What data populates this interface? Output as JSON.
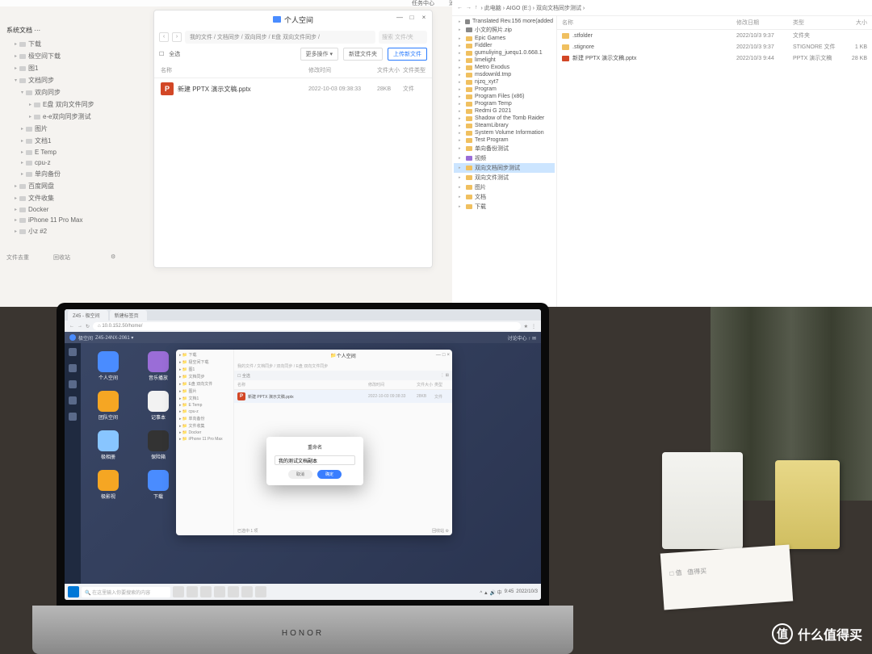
{
  "monitor": {
    "topbar": [
      "任务中心",
      "消息",
      "●",
      "●"
    ],
    "side_tree": {
      "header": "系统文档  ···",
      "items": [
        {
          "l": "下载",
          "i": 0
        },
        {
          "l": "极空间下载",
          "i": 0
        },
        {
          "l": "图1",
          "i": 0
        },
        {
          "l": "文档同步",
          "i": 0,
          "exp": true
        },
        {
          "l": "双向同步",
          "i": 1,
          "exp": true
        },
        {
          "l": "E盘 双向文件同步",
          "i": 2
        },
        {
          "l": "e-e双向同步测试",
          "i": 2
        },
        {
          "l": "图片",
          "i": 1
        },
        {
          "l": "文档1",
          "i": 1
        },
        {
          "l": "E Temp",
          "i": 1
        },
        {
          "l": "cpu-z",
          "i": 1
        },
        {
          "l": "单向备份",
          "i": 1
        },
        {
          "l": "百度网盘",
          "i": 0
        },
        {
          "l": "文件收集",
          "i": 0
        },
        {
          "l": "Docker",
          "i": 0
        },
        {
          "l": "iPhone 11 Pro Max",
          "i": 0
        },
        {
          "l": "小z #2",
          "i": 0
        }
      ],
      "footer": [
        "文件去重",
        "回收站",
        "⚙"
      ]
    },
    "nas_win": {
      "title": "个人空间",
      "nav_arrows": [
        "‹",
        "›"
      ],
      "breadcrumb": "我的文件 / 文档同步 / 双向同步 / E盘 双向文件同步 /",
      "search_ph": "搜索 文件/夹",
      "toolbar": {
        "all": "全选",
        "more": "更多操作 ▾",
        "new": "新建文件夹",
        "upload": "上传新文件"
      },
      "columns": [
        "名称",
        "修改时间",
        "文件大小",
        "文件类型"
      ],
      "rows": [
        {
          "name": "新建 PPTX 演示文稿.pptx",
          "date": "2022-10-03 09:38:33",
          "size": "28KB",
          "type": "文件"
        }
      ]
    },
    "explorer": {
      "addr": {
        "arrows": [
          "←",
          "→",
          "↑"
        ],
        "path": "› 此电脑 › AIGO (E:) › 双向文档同步测试 ›"
      },
      "tree": [
        {
          "l": "Translated Rev.156 more(added",
          "ic": "gr"
        },
        {
          "l": "小文的照片.zip",
          "ic": "gr"
        },
        {
          "l": "Epic Games"
        },
        {
          "l": "Fiddler"
        },
        {
          "l": "gumuliying_juequ1.0.668.1"
        },
        {
          "l": "limelight"
        },
        {
          "l": "Metro Exodus"
        },
        {
          "l": "msdownld.tmp"
        },
        {
          "l": "njzq_xyt7"
        },
        {
          "l": "Program"
        },
        {
          "l": "Program Files (x86)"
        },
        {
          "l": "Program Temp"
        },
        {
          "l": "Redmi G 2021"
        },
        {
          "l": "Shadow of the Tomb Raider"
        },
        {
          "l": "SteamLibrary"
        },
        {
          "l": "System Volume Information"
        },
        {
          "l": "Test Program"
        },
        {
          "l": "单向备份测试"
        },
        {
          "l": "视频",
          "ic": "pur"
        },
        {
          "l": "双向文档同步测试",
          "sel": true
        },
        {
          "l": "双向文件测试"
        },
        {
          "l": "图片"
        },
        {
          "l": "文档"
        },
        {
          "l": "下载"
        }
      ],
      "columns": [
        "名称",
        "修改日期",
        "类型",
        "大小"
      ],
      "rows": [
        {
          "name": ".stfolder",
          "date": "2022/10/3 9:37",
          "type": "文件夹",
          "size": ""
        },
        {
          "name": ".stignore",
          "date": "2022/10/3 9:37",
          "type": "STIGNORE 文件",
          "size": "1 KB"
        },
        {
          "name": "新建 PPTX 演示文稿.pptx",
          "date": "2022/10/3 9:44",
          "type": "PPTX 演示文稿",
          "size": "28 KB",
          "ppt": true
        }
      ]
    }
  },
  "laptop": {
    "brand": "HONOR",
    "tabs": [
      "Z45 - 极空间",
      "新建标签页"
    ],
    "url": "⌂  10.0.152.50/home/",
    "nas_bar": {
      "logo": "极空间",
      "user": "Z45-24NX-2061 ▾",
      "tray": "讨论中心  ↑  ✉"
    },
    "strip_count": 5,
    "desk_icons": [
      {
        "l": "个人空间",
        "c": "blue"
      },
      {
        "l": "音乐播放",
        "c": "pur"
      },
      {
        "l": "团队空间",
        "c": "yel"
      },
      {
        "l": "记事本",
        "c": "wht"
      },
      {
        "l": "极相册",
        "c": "sky"
      },
      {
        "l": "保险箱",
        "c": "dk"
      },
      {
        "l": "极影视",
        "c": "yel"
      },
      {
        "l": "下载",
        "c": "blue"
      }
    ],
    "sub_win": {
      "title": "个人空间",
      "side": [
        "下载",
        "极空间下载",
        "图1",
        "文档同步",
        "E盘 双向文件",
        "图片",
        "文档1",
        "E Temp",
        "cpu-z",
        "单向备份",
        "文件收集",
        "Docker",
        "iPhone 11 Pro Max"
      ],
      "breadcrumb": "我的文件 / 文档同步 / 双向同步 / E盘 双向文件同步",
      "columns": [
        "名称",
        "修改时间",
        "文件大小",
        "类型"
      ],
      "rows": [
        {
          "name": "新建 PPTX 演示文稿.pptx",
          "date": "2022-10-03 09:38:33",
          "size": "28KB",
          "type": "文件"
        }
      ],
      "footer_left": "已选中 1 项",
      "footer_right": "回收站  ⚙"
    },
    "dialog": {
      "title": "重命名",
      "value": "我的测试文档副本",
      "cancel": "取消",
      "ok": "确定"
    },
    "taskbar": {
      "search_ph": "在这里输入你要搜索的内容",
      "time": "9:45",
      "date": "2022/10/3"
    }
  },
  "watermark": "什么值得买"
}
